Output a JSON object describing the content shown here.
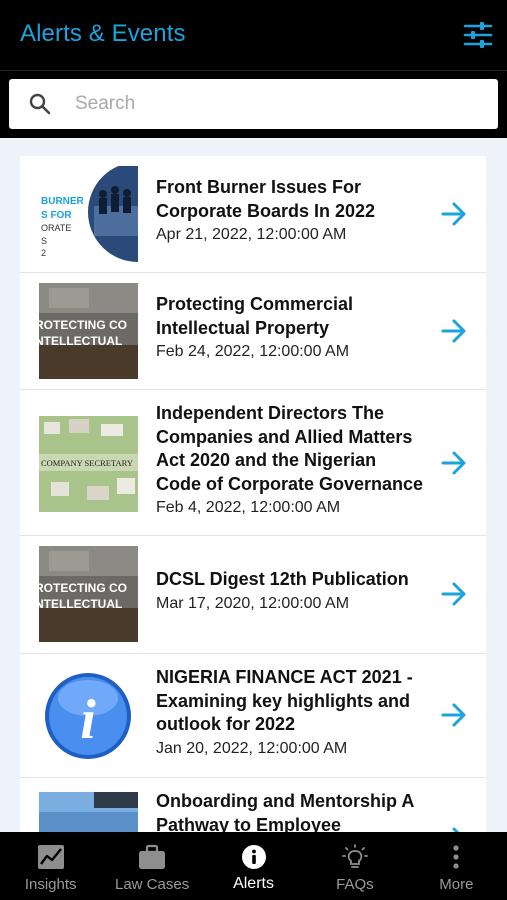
{
  "header": {
    "title": "Alerts & Events",
    "filter_icon": "sliders-icon"
  },
  "search": {
    "placeholder": "Search",
    "value": "",
    "icon": "search-icon"
  },
  "colors": {
    "accent": "#1ba3dd",
    "background": "#eef3f9",
    "nav_bg": "#000000"
  },
  "items": [
    {
      "title_lines": [
        "Front Burner Issues For",
        "Corporate Boards In 2022"
      ],
      "date": "Apr 21, 2022, 12:00:00 AM",
      "thumb_text": [
        "BURNER",
        "S FOR",
        "ORATE",
        "S",
        "2"
      ]
    },
    {
      "title_lines": [
        "Protecting Commercial",
        "Intellectual Property"
      ],
      "date": "Feb 24, 2022, 12:00:00 AM",
      "thumb_text": [
        "ROTECTING CO",
        "NTELLECTUAL"
      ]
    },
    {
      "title_lines": [
        "Independent Directors The",
        "Companies and Allied Matters",
        "Act 2020 and the Nigerian",
        "Code of Corporate Governance"
      ],
      "date": "Feb 4, 2022, 12:00:00 AM",
      "thumb_text": [
        "COMPANY SECRETARY"
      ]
    },
    {
      "title_lines": [
        "DCSL Digest 12th Publication"
      ],
      "date": "Mar 17, 2020, 12:00:00 AM",
      "thumb_text": [
        "ROTECTING CO",
        "NTELLECTUAL"
      ]
    },
    {
      "title_lines": [
        "NIGERIA FINANCE ACT 2021 -",
        "Examining key highlights and",
        "outlook for 2022"
      ],
      "date": "Jan 20, 2022, 12:00:00 AM",
      "thumb_text": [
        "i"
      ]
    },
    {
      "title_lines": [
        "Onboarding and Mentorship A",
        "Pathway to Employee"
      ],
      "date": "",
      "thumb_text": []
    }
  ],
  "nav": [
    {
      "label": "Insights",
      "icon": "chart-icon",
      "active": false
    },
    {
      "label": "Law Cases",
      "icon": "briefcase-icon",
      "active": false
    },
    {
      "label": "Alerts",
      "icon": "info-icon",
      "active": true
    },
    {
      "label": "FAQs",
      "icon": "lightbulb-icon",
      "active": false
    },
    {
      "label": "More",
      "icon": "more-vertical-icon",
      "active": false
    }
  ]
}
